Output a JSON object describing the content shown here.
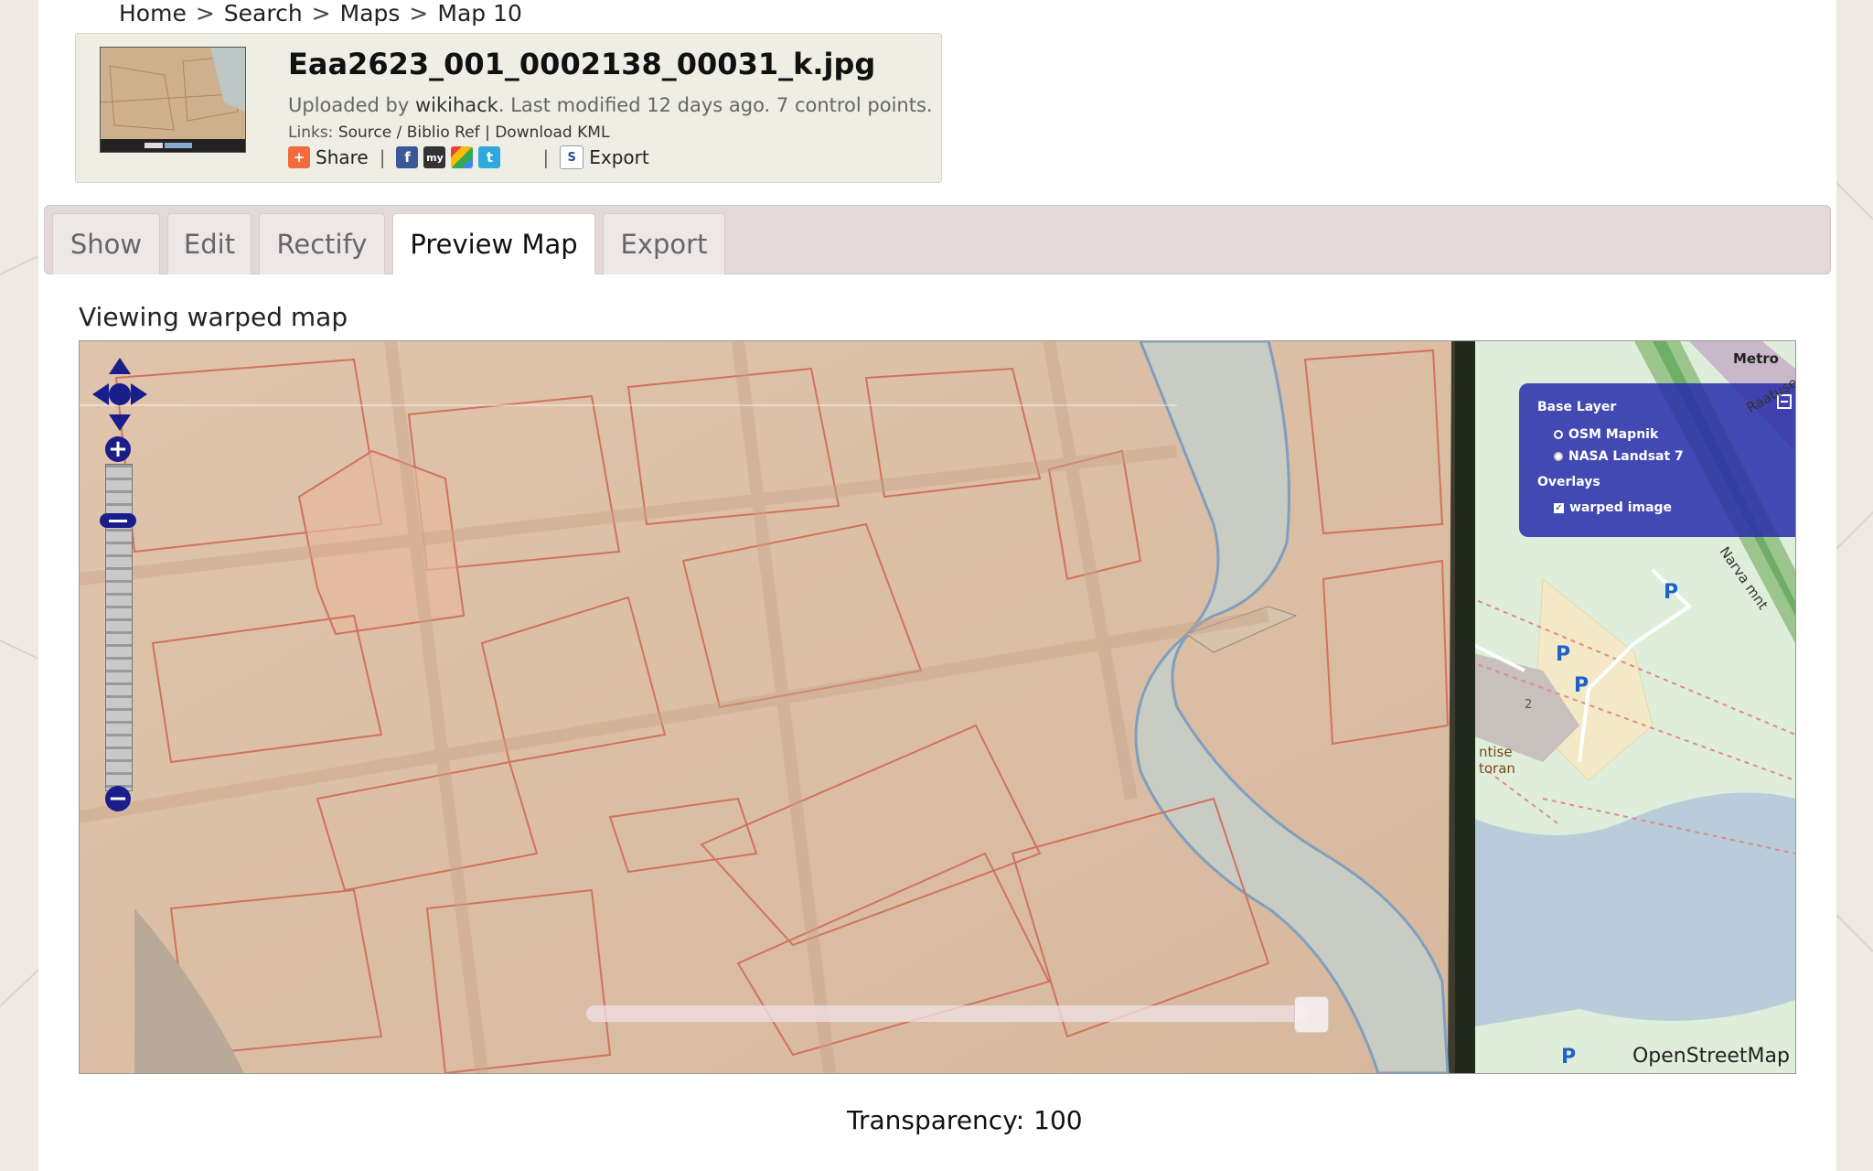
{
  "breadcrumb": {
    "items": [
      "Home",
      "Search",
      "Maps",
      "Map 10"
    ],
    "separator": ">"
  },
  "header": {
    "title": "Eaa2623_001_0002138_00031_k.jpg",
    "meta_prefix": "Uploaded by",
    "uploader": "wikihack",
    "meta_suffix": ". Last modified 12 days ago. 7 control points.",
    "links_label": "Links:",
    "link_source": "Source",
    "link_biblio": "Biblio Ref",
    "link_kml": "Download KML",
    "share_label": "Share",
    "export_label": "Export"
  },
  "tabs": [
    "Show",
    "Edit",
    "Rectify",
    "Preview Map",
    "Export"
  ],
  "active_tab": "Preview Map",
  "section_title": "Viewing warped map",
  "map": {
    "layer_switcher": {
      "base_title": "Base Layer",
      "base_layers": [
        "OSM Mapnik",
        "NASA Landsat 7"
      ],
      "selected_base": "OSM Mapnik",
      "overlays_title": "Overlays",
      "overlays": [
        "warped image"
      ]
    },
    "labels": {
      "metro": "Metro",
      "street1": "Raatuse",
      "street2": "Narva mnt",
      "shop1": "ntise",
      "shop2": "toran",
      "parking": "P",
      "bldg": "2"
    },
    "attribution": "OpenStreetMap"
  },
  "transparency": {
    "label": "Transparency:",
    "value": "100"
  },
  "colors": {
    "accent": "#1a1e8a",
    "tab_bg": "#e4d9da",
    "header_bg": "#efeee4"
  }
}
